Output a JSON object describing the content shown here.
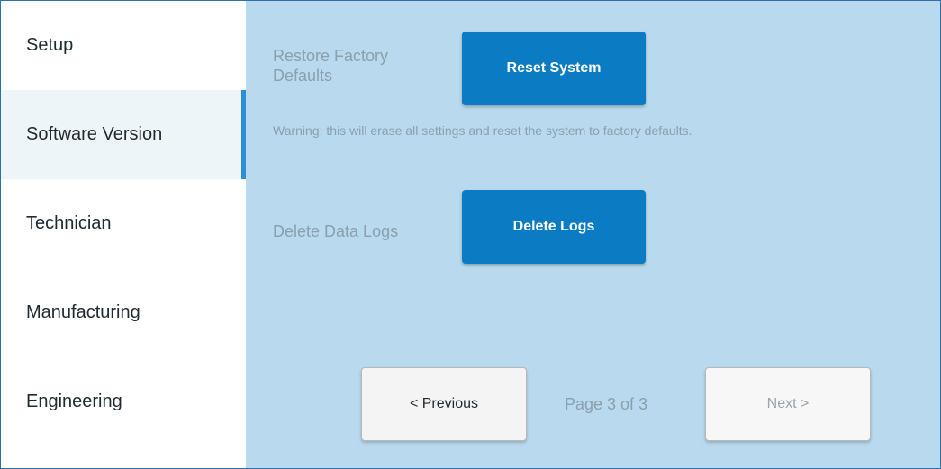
{
  "sidebar": {
    "items": [
      {
        "label": "Setup"
      },
      {
        "label": "Software Version"
      },
      {
        "label": "Technician"
      },
      {
        "label": "Manufacturing"
      },
      {
        "label": "Engineering"
      }
    ],
    "active_index": 1
  },
  "main": {
    "restore": {
      "label": "Restore Factory Defaults",
      "button_label": "Reset System",
      "warning": "Warning: this will erase all settings and reset the system to factory defaults."
    },
    "logs": {
      "label": "Delete Data Logs",
      "button_label": "Delete Logs"
    },
    "pagination": {
      "previous_label": "< Previous",
      "page_text": "Page 3 of 3",
      "next_label": "Next >"
    }
  },
  "colors": {
    "primary_button": "#0b7cc4",
    "main_background": "#b8d9ee",
    "active_indicator": "#2a8fd4",
    "frame_border": "#2e6fa8"
  }
}
